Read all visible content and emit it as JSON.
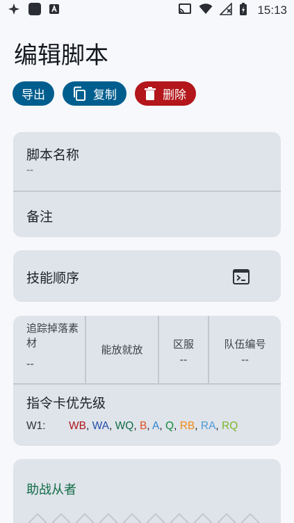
{
  "status_bar": {
    "time": "15:13"
  },
  "page": {
    "title": "编辑脚本"
  },
  "actions": {
    "export_label": "导出",
    "copy_label": "复制",
    "delete_label": "删除"
  },
  "colors": {
    "primary": "#005e8f",
    "danger": "#b3161b",
    "card_bg": "#dfe3ea",
    "support_title": "#0f6b45"
  },
  "script_info": {
    "name_label": "脚本名称",
    "name_value": "--",
    "note_label": "备注"
  },
  "skill": {
    "label": "技能顺序"
  },
  "stats": {
    "track_drops_label": "追踪掉落素材",
    "track_drops_value": "--",
    "cast_when_ready_label": "能放就放",
    "server_label": "区服",
    "server_value": "--",
    "team_label": "队伍编号",
    "team_value": "--"
  },
  "card_priority": {
    "title": "指令卡优先级",
    "wave_label": "W1:",
    "items": [
      "WB",
      "WA",
      "WQ",
      "B",
      "A",
      "Q",
      "RB",
      "RA",
      "RQ"
    ]
  },
  "support": {
    "title": "助战从者"
  }
}
